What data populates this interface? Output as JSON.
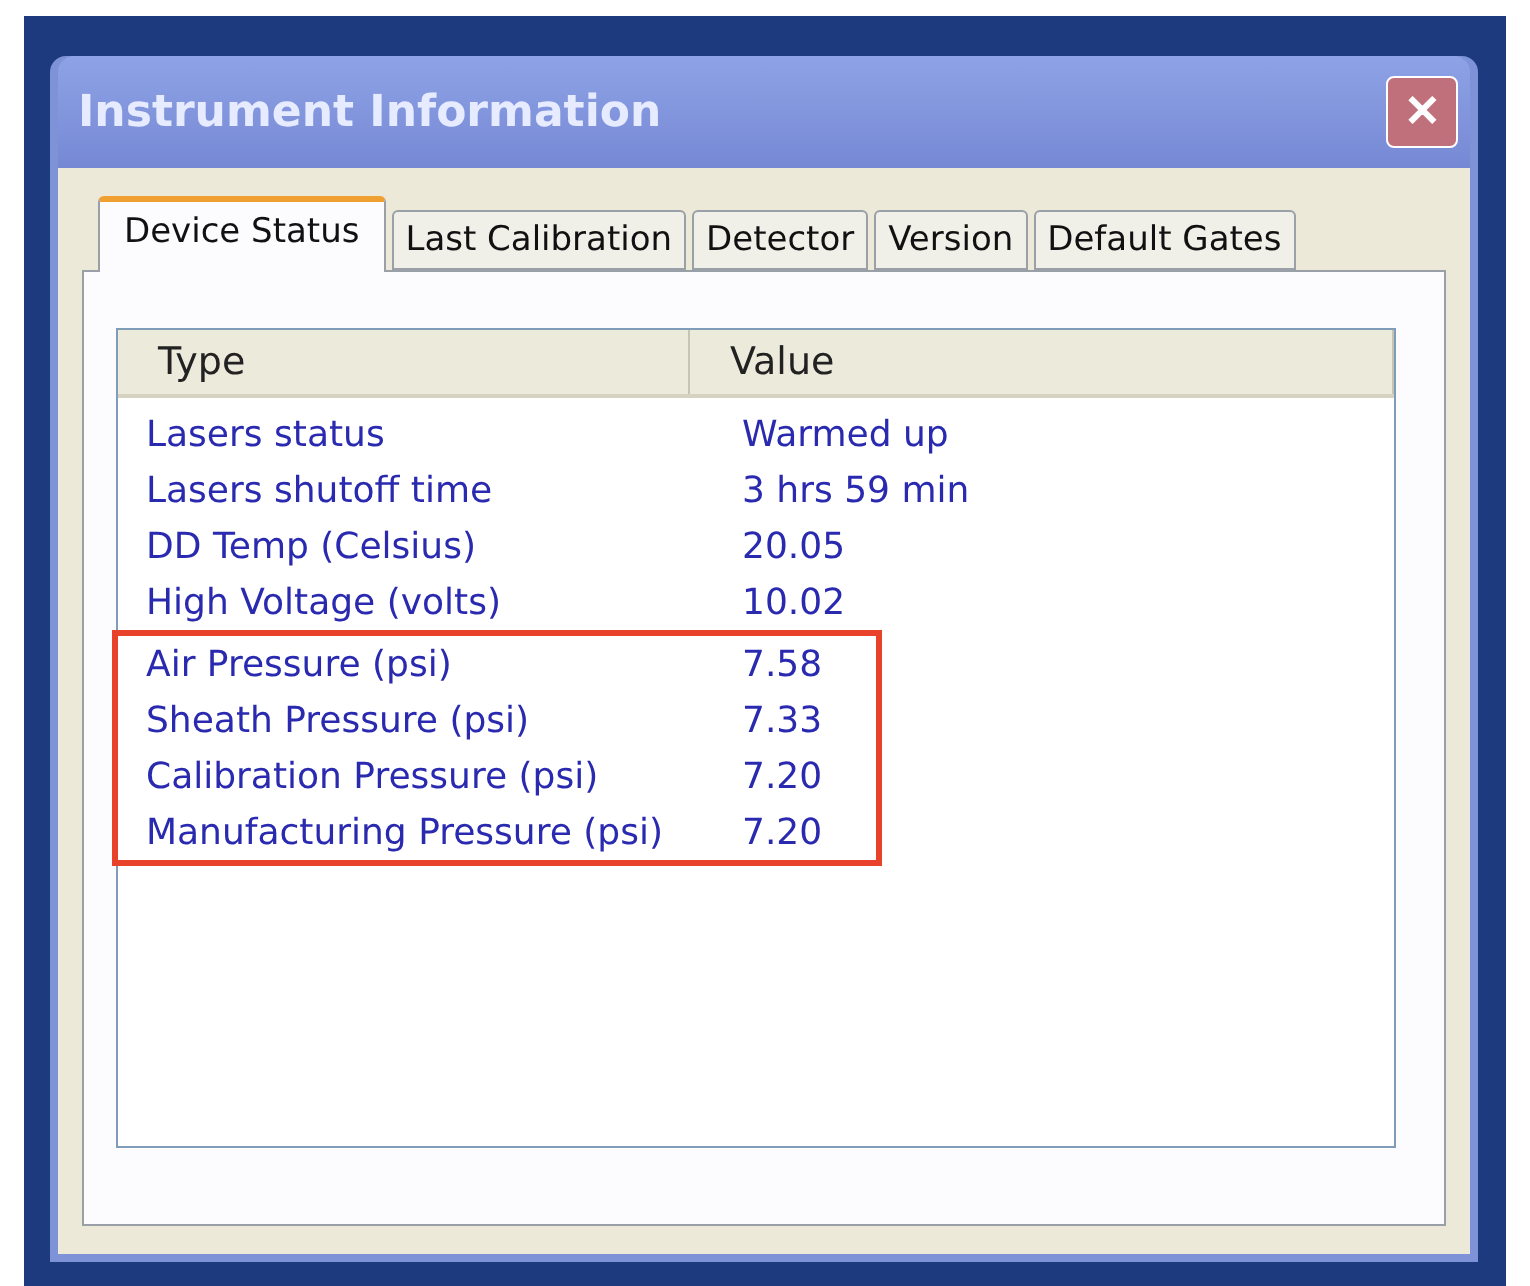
{
  "window": {
    "title": "Instrument Information",
    "close": "✕"
  },
  "tabs": [
    {
      "label": "Device Status",
      "selected": true
    },
    {
      "label": "Last Calibration",
      "selected": false
    },
    {
      "label": "Detector",
      "selected": false
    },
    {
      "label": "Version",
      "selected": false
    },
    {
      "label": "Default Gates",
      "selected": false
    }
  ],
  "table": {
    "columns": [
      "Type",
      "Value"
    ],
    "rows": [
      {
        "type": "Lasers status",
        "value": "Warmed up",
        "highlighted": false
      },
      {
        "type": "Lasers shutoff time",
        "value": "3 hrs 59 min",
        "highlighted": false
      },
      {
        "type": "DD Temp (Celsius)",
        "value": "20.05",
        "highlighted": false
      },
      {
        "type": "High Voltage (volts)",
        "value": "10.02",
        "highlighted": false
      },
      {
        "type": "Air Pressure (psi)",
        "value": "7.58",
        "highlighted": true
      },
      {
        "type": "Sheath Pressure (psi)",
        "value": "7.33",
        "highlighted": true
      },
      {
        "type": "Calibration Pressure (psi)",
        "value": "7.20",
        "highlighted": true
      },
      {
        "type": "Manufacturing Pressure (psi)",
        "value": "7.20",
        "highlighted": true
      }
    ]
  }
}
